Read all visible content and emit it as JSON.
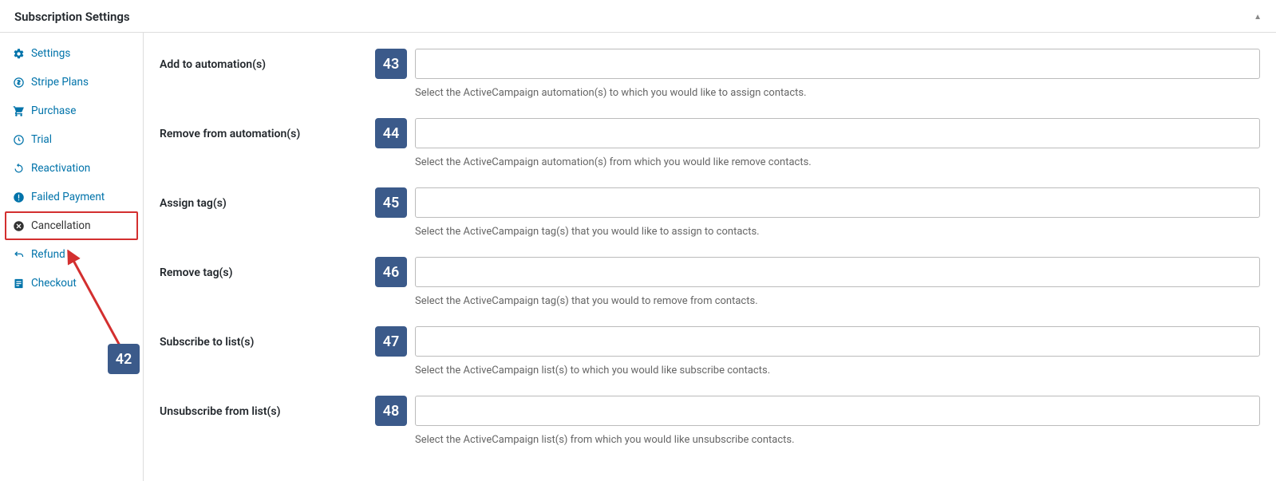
{
  "header": {
    "title": "Subscription Settings"
  },
  "sidebar": {
    "items": [
      {
        "label": "Settings"
      },
      {
        "label": "Stripe Plans"
      },
      {
        "label": "Purchase"
      },
      {
        "label": "Trial"
      },
      {
        "label": "Reactivation"
      },
      {
        "label": "Failed Payment"
      },
      {
        "label": "Cancellation"
      },
      {
        "label": "Refund"
      },
      {
        "label": "Checkout"
      }
    ]
  },
  "annotations": {
    "sidebar_badge": "42"
  },
  "fields": [
    {
      "label": "Add to automation(s)",
      "badge": "43",
      "help": "Select the ActiveCampaign automation(s) to which you would like to assign contacts."
    },
    {
      "label": "Remove from automation(s)",
      "badge": "44",
      "help": "Select the ActiveCampaign automation(s) from which you would like remove contacts."
    },
    {
      "label": "Assign tag(s)",
      "badge": "45",
      "help": "Select the ActiveCampaign tag(s) that you would like to assign to contacts."
    },
    {
      "label": "Remove tag(s)",
      "badge": "46",
      "help": "Select the ActiveCampaign tag(s) that you would to remove from contacts."
    },
    {
      "label": "Subscribe to list(s)",
      "badge": "47",
      "help": "Select the ActiveCampaign list(s) to which you would like subscribe contacts."
    },
    {
      "label": "Unsubscribe from list(s)",
      "badge": "48",
      "help": "Select the ActiveCampaign list(s) from which you would like unsubscribe contacts."
    }
  ]
}
